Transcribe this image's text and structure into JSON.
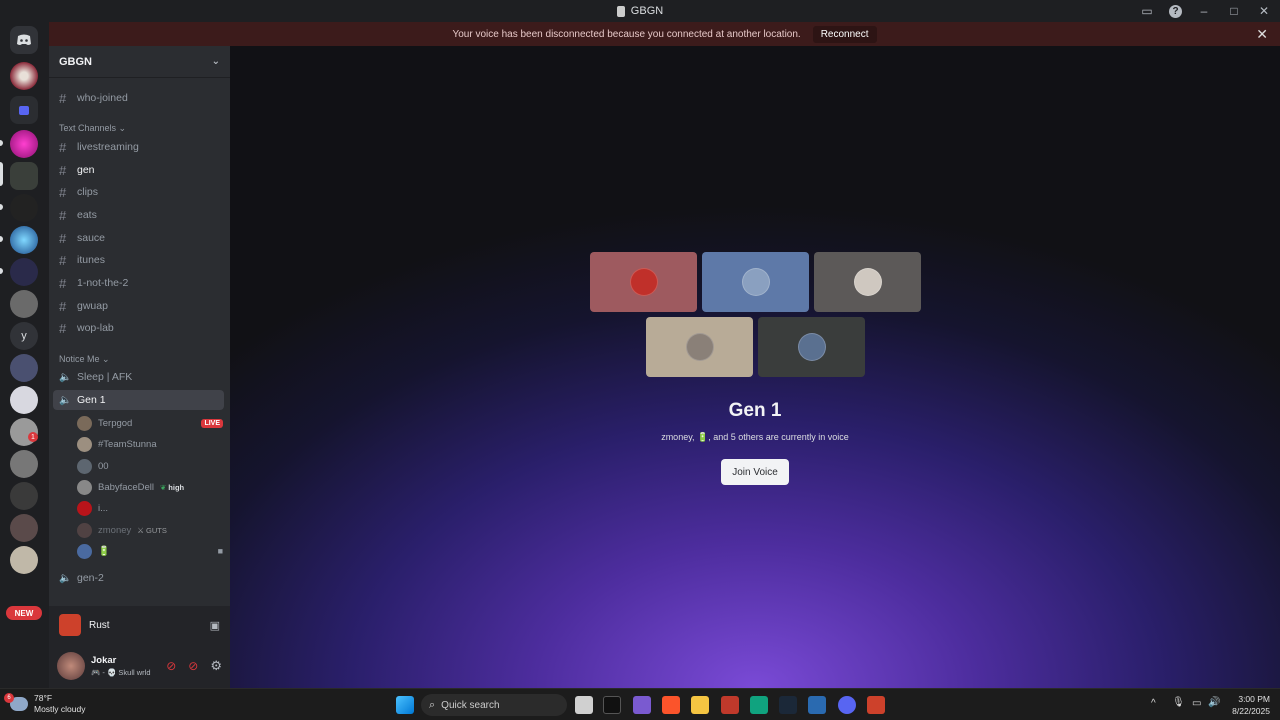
{
  "window": {
    "title": "GBGN"
  },
  "banner": {
    "message": "Your voice has been disconnected because you connected at another location.",
    "reconnect_label": "Reconnect"
  },
  "server": {
    "name": "GBGN"
  },
  "guilds": {
    "letter_label": "y",
    "new_badge": "NEW",
    "mention_count": "1"
  },
  "channels": {
    "top": [
      {
        "name": "who-joined"
      }
    ],
    "text_category": "Text Channels",
    "text": [
      {
        "name": "livestreaming"
      },
      {
        "name": "gen"
      },
      {
        "name": "clips"
      },
      {
        "name": "eats"
      },
      {
        "name": "sauce"
      },
      {
        "name": "itunes"
      },
      {
        "name": "1-not-the-2"
      },
      {
        "name": "gwuap"
      },
      {
        "name": "wop-lab"
      }
    ],
    "voice_category": "Notice Me",
    "voice": [
      {
        "name": "Sleep | AFK"
      },
      {
        "name": "Gen 1"
      },
      {
        "name": "gen-2"
      }
    ]
  },
  "voice_users": [
    {
      "name": "Terpgod",
      "badge": "LIVE",
      "avatar_color": "#7a6a5a"
    },
    {
      "name": "#TeamStunna",
      "avatar_color": "#9c8f80"
    },
    {
      "name": "00",
      "avatar_color": "#5d6670"
    },
    {
      "name": "BabyfaceDell",
      "tag": "high",
      "avatar_color": "#888888"
    },
    {
      "name": "i...",
      "avatar_color": "#b8141a"
    },
    {
      "name": "zmoney",
      "tag": "GUTS",
      "avatar_color": "#6a5050"
    },
    {
      "name": "🔋",
      "avatar_color": "#4a6aa0"
    }
  ],
  "activity": {
    "game": "Rust"
  },
  "user": {
    "name": "Jokar",
    "status": "🎮 - 💀 Skull wrld"
  },
  "voice_panel": {
    "title": "Gen 1",
    "subtitle": "zmoney, 🔋, and 5 others are currently in voice",
    "join_label": "Join Voice",
    "tiles": [
      {
        "color": "#9e5a5f"
      },
      {
        "color": "#5e79a8"
      },
      {
        "color": "#5c5958"
      },
      {
        "color": "#b8ab97"
      },
      {
        "color": "#3a3d3c"
      }
    ]
  },
  "taskbar": {
    "weather_temp": "78°F",
    "weather_desc": "Mostly cloudy",
    "weather_badge": "6",
    "search_placeholder": "Quick search",
    "time": "3:00 PM",
    "date": "8/22/2025"
  }
}
